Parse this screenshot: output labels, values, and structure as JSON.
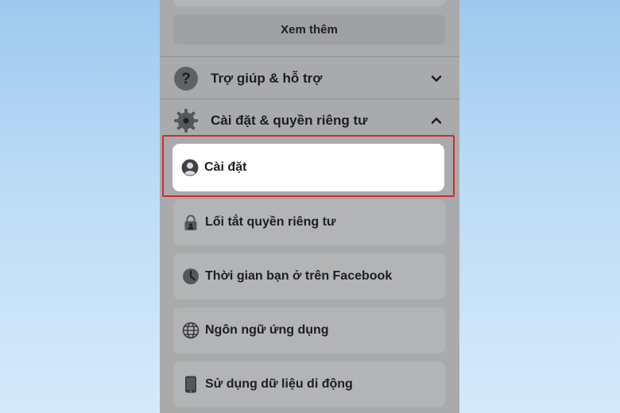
{
  "see_more": {
    "label": "Xem thêm"
  },
  "sections": {
    "help": {
      "label": "Trợ giúp & hỗ trợ",
      "icon": "question-icon",
      "expanded": false
    },
    "settings_privacy": {
      "label": "Cài đặt & quyền riêng tư",
      "icon": "gear-icon",
      "expanded": true
    }
  },
  "menu": {
    "settings": {
      "label": "Cài đặt",
      "icon": "profile-icon",
      "highlighted": true
    },
    "privacy_shortcuts": {
      "label": "Lối tắt quyền riêng tư",
      "icon": "lock-icon"
    },
    "time_on_facebook": {
      "label": "Thời gian bạn ở trên Facebook",
      "icon": "clock-icon"
    },
    "app_language": {
      "label": "Ngôn ngữ ứng dụng",
      "icon": "globe-icon"
    },
    "mobile_data": {
      "label": "Sử dụng dữ liệu di động",
      "icon": "phone-icon"
    }
  },
  "colors": {
    "highlight_border": "#d42a2a",
    "background_gradient_top": "#9ec9ee",
    "dimmed_panel": "#a9aaab"
  }
}
